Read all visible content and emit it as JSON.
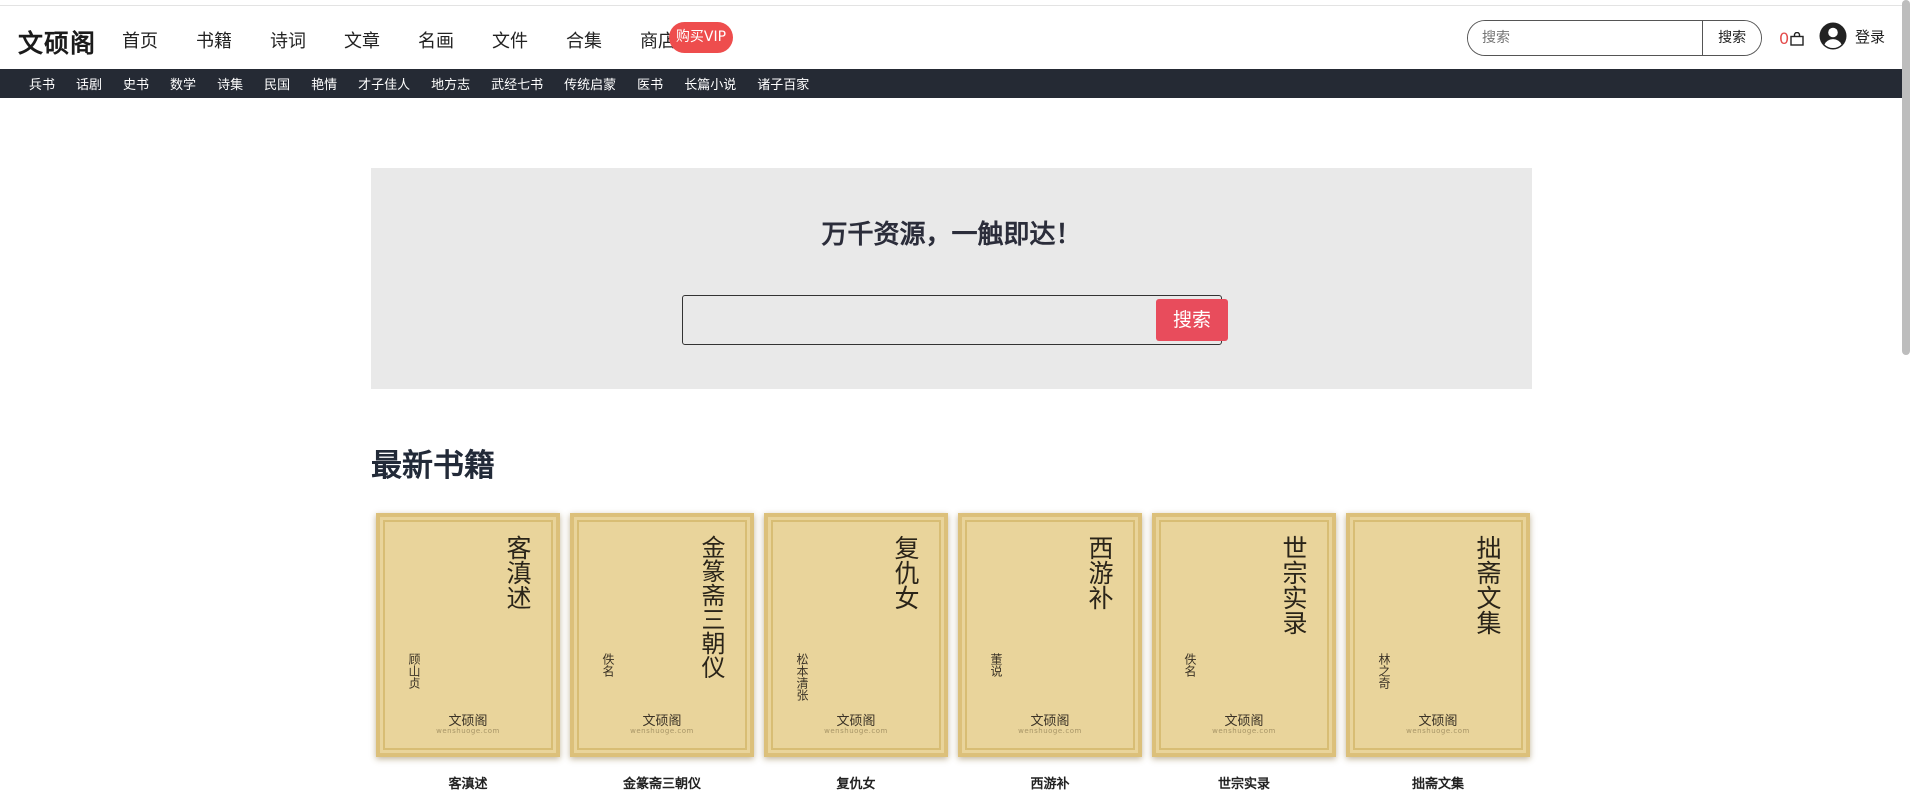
{
  "header": {
    "logo": "文硕阁",
    "nav": [
      "首页",
      "书籍",
      "诗词",
      "文章",
      "名画",
      "文件",
      "合集",
      "商店"
    ],
    "vip_label": "购买VIP",
    "search_placeholder": "搜索",
    "search_button": "搜索",
    "cart_count": "0",
    "login_label": "登录"
  },
  "categories": [
    "兵书",
    "话剧",
    "史书",
    "数学",
    "诗集",
    "民国",
    "艳情",
    "才子佳人",
    "地方志",
    "武经七书",
    "传统启蒙",
    "医书",
    "长篇小说",
    "诸子百家"
  ],
  "hero": {
    "title": "万千资源，一触即达！",
    "search_button": "搜索",
    "search_value": ""
  },
  "section_title": "最新书籍",
  "books": [
    {
      "title": "客滇述",
      "author": "顾山贞",
      "brand": "文硕阁",
      "domain": "wenshuoge.com"
    },
    {
      "title": "金篆斋三朝仪",
      "author": "佚名",
      "brand": "文硕阁",
      "domain": "wenshuoge.com"
    },
    {
      "title": "复仇女",
      "author": "松本清张",
      "brand": "文硕阁",
      "domain": "wenshuoge.com"
    },
    {
      "title": "西游补",
      "author": "董说",
      "brand": "文硕阁",
      "domain": "wenshuoge.com"
    },
    {
      "title": "世宗实录",
      "author": "佚名",
      "brand": "文硕阁",
      "domain": "wenshuoge.com"
    },
    {
      "title": "拙斋文集",
      "author": "林之奇",
      "brand": "文硕阁",
      "domain": "wenshuoge.com"
    }
  ],
  "colors": {
    "accent_red": "#e84c5c",
    "vip_red": "#ee4d4d",
    "category_bar": "#252a34",
    "hero_bg": "#e9e9e9",
    "cover_bg": "#e9d49b"
  }
}
